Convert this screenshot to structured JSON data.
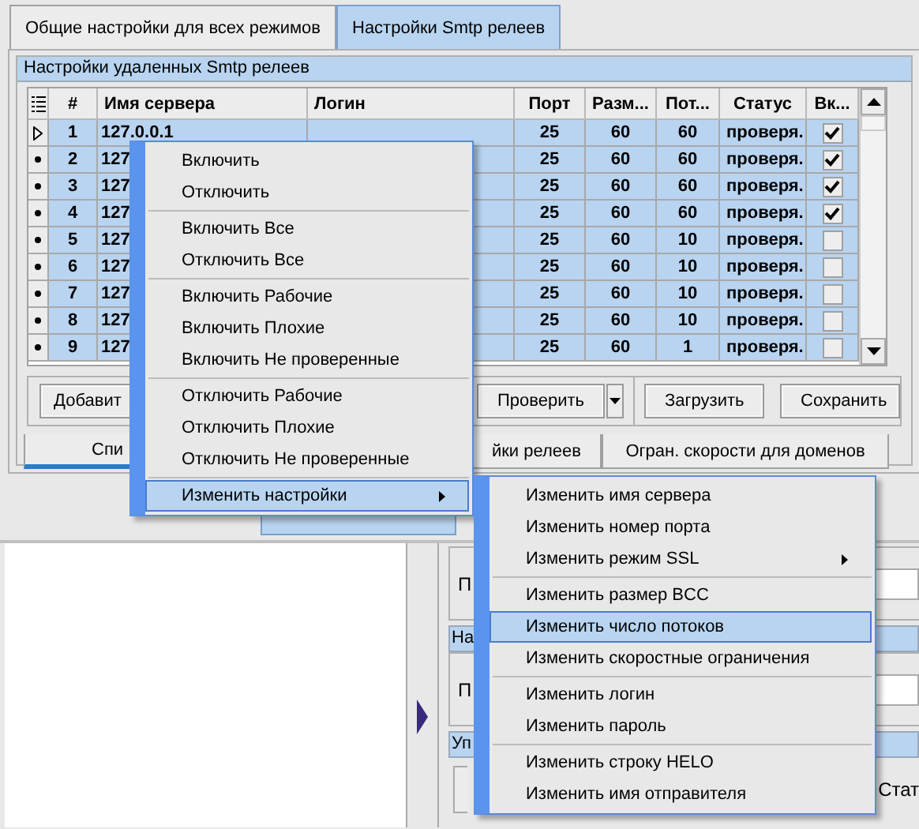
{
  "tabs": [
    {
      "label": "Общие настройки для всех режимов",
      "selected": false
    },
    {
      "label": "Настройки Smtp релеев",
      "selected": true
    }
  ],
  "relay_group": {
    "title": "Настройки удаленных Smtp релеев",
    "table": {
      "columns": [
        "#",
        "Имя сервера",
        "Логин",
        "Порт",
        "Разм...",
        "Пот...",
        "Статус",
        "Вк..."
      ],
      "rows": [
        {
          "num": "1",
          "server": "127.0.0.1",
          "port": "25",
          "size": "60",
          "threads": "60",
          "status": "проверя.",
          "enabled": true,
          "current": true
        },
        {
          "num": "2",
          "server": "127",
          "port": "25",
          "size": "60",
          "threads": "60",
          "status": "проверя.",
          "enabled": true,
          "current": false
        },
        {
          "num": "3",
          "server": "127",
          "port": "25",
          "size": "60",
          "threads": "60",
          "status": "проверя.",
          "enabled": true,
          "current": false
        },
        {
          "num": "4",
          "server": "127",
          "port": "25",
          "size": "60",
          "threads": "60",
          "status": "проверя.",
          "enabled": true,
          "current": false
        },
        {
          "num": "5",
          "server": "127",
          "port": "25",
          "size": "60",
          "threads": "10",
          "status": "проверя.",
          "enabled": false,
          "current": false
        },
        {
          "num": "6",
          "server": "127",
          "port": "25",
          "size": "60",
          "threads": "10",
          "status": "проверя.",
          "enabled": false,
          "current": false
        },
        {
          "num": "7",
          "server": "127",
          "port": "25",
          "size": "60",
          "threads": "10",
          "status": "проверя.",
          "enabled": false,
          "current": false
        },
        {
          "num": "8",
          "server": "127",
          "port": "25",
          "size": "60",
          "threads": "10",
          "status": "проверя.",
          "enabled": false,
          "current": false
        },
        {
          "num": "9",
          "server": "127",
          "port": "25",
          "size": "60",
          "threads": "1",
          "status": "проверя.",
          "enabled": false,
          "current": false
        }
      ]
    },
    "buttons": [
      {
        "label": "Добавит",
        "kind": "plain"
      },
      {
        "label": "Проверить",
        "kind": "split"
      },
      {
        "label": "Загрузить",
        "kind": "plain"
      },
      {
        "label": "Сохранить",
        "kind": "plain"
      }
    ],
    "bottom_tabs": [
      {
        "label": "Спи",
        "selected": true
      },
      {
        "label": "йки релеев",
        "selected": false
      },
      {
        "label": "Огран. скорости для доменов",
        "selected": false
      }
    ]
  },
  "lower_panel": {
    "fragments": [
      {
        "label": "П",
        "kind": "label"
      },
      {
        "label": "На",
        "kind": "group_title"
      },
      {
        "label": "П",
        "kind": "label"
      },
      {
        "label": "Уп",
        "kind": "group_title"
      },
      {
        "label": "Стат",
        "kind": "button"
      }
    ]
  },
  "context_menu": {
    "groups": [
      [
        {
          "label": "Включить",
          "selected": false,
          "has_submenu": false
        },
        {
          "label": "Отключить",
          "selected": false,
          "has_submenu": false
        }
      ],
      [
        {
          "label": "Включить Все",
          "selected": false,
          "has_submenu": false
        },
        {
          "label": "Отключить Все",
          "selected": false,
          "has_submenu": false
        }
      ],
      [
        {
          "label": "Включить Рабочие",
          "selected": false,
          "has_submenu": false
        },
        {
          "label": "Включить Плохие",
          "selected": false,
          "has_submenu": false
        },
        {
          "label": "Включить Не проверенные",
          "selected": false,
          "has_submenu": false
        }
      ],
      [
        {
          "label": "Отключить Рабочие",
          "selected": false,
          "has_submenu": false
        },
        {
          "label": "Отключить Плохие",
          "selected": false,
          "has_submenu": false
        },
        {
          "label": "Отключить Не проверенные",
          "selected": false,
          "has_submenu": false
        }
      ],
      [
        {
          "label": "Изменить настройки",
          "selected": true,
          "has_submenu": true
        }
      ]
    ]
  },
  "submenu": {
    "groups": [
      [
        {
          "label": "Изменить имя сервера",
          "selected": false,
          "has_submenu": false
        },
        {
          "label": "Изменить номер порта",
          "selected": false,
          "has_submenu": false
        },
        {
          "label": "Изменить режим SSL",
          "selected": false,
          "has_submenu": true
        }
      ],
      [
        {
          "label": "Изменить размер BCC",
          "selected": false,
          "has_submenu": false
        },
        {
          "label": "Изменить число потоков",
          "selected": true,
          "has_submenu": false
        },
        {
          "label": "Изменить скоростные ограничения",
          "selected": false,
          "has_submenu": false
        }
      ],
      [
        {
          "label": "Изменить логин",
          "selected": false,
          "has_submenu": false
        },
        {
          "label": "Изменить пароль",
          "selected": false,
          "has_submenu": false
        }
      ],
      [
        {
          "label": "Изменить строку HELO",
          "selected": false,
          "has_submenu": false
        },
        {
          "label": "Изменить имя отправителя",
          "selected": false,
          "has_submenu": false
        }
      ]
    ]
  }
}
